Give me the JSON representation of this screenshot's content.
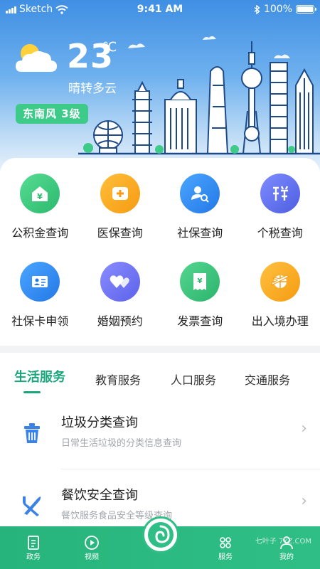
{
  "status": {
    "carrier": "Sketch",
    "time": "9:41 AM",
    "battery": "100%"
  },
  "weather": {
    "temperature": "23",
    "unit": "℃",
    "description": "晴转多云",
    "wind": "东南风  3级"
  },
  "services": [
    {
      "label": "公积金查询",
      "icon": "house-yuan-icon",
      "color": "#3ac97c"
    },
    {
      "label": "医保查询",
      "icon": "medical-cross-icon",
      "color": "#f7a21b"
    },
    {
      "label": "社保查询",
      "icon": "person-search-icon",
      "color": "#2f8cf0"
    },
    {
      "label": "个税查询",
      "icon": "tax-icon",
      "color": "#5b6ee8"
    },
    {
      "label": "社保卡申领",
      "icon": "id-card-icon",
      "color": "#2f8cf0"
    },
    {
      "label": "婚姻预约",
      "icon": "hearts-icon",
      "color": "#6a6ff0"
    },
    {
      "label": "发票查询",
      "icon": "receipt-icon",
      "color": "#33c07a"
    },
    {
      "label": "出入境办理",
      "icon": "plane-globe-icon",
      "color": "#f7a21b"
    }
  ],
  "tabs": [
    {
      "label": "生活服务",
      "active": true
    },
    {
      "label": "教育服务",
      "active": false
    },
    {
      "label": "人口服务",
      "active": false
    },
    {
      "label": "交通服务",
      "active": false
    }
  ],
  "list": [
    {
      "title": "垃圾分类查询",
      "subtitle": "日常生活垃圾的分类信息查询",
      "icon": "trash-icon"
    },
    {
      "title": "餐饮安全查询",
      "subtitle": "餐饮服务食品安全等级查询",
      "icon": "fork-knife-icon"
    }
  ],
  "nav": {
    "items": [
      {
        "label": "政务",
        "icon": "document-icon"
      },
      {
        "label": "视频",
        "icon": "play-icon"
      },
      {
        "label": "服务",
        "icon": "grid-icon"
      },
      {
        "label": "我的",
        "icon": "person-icon"
      }
    ],
    "watermark": "七叶子 7YZ.COM"
  }
}
